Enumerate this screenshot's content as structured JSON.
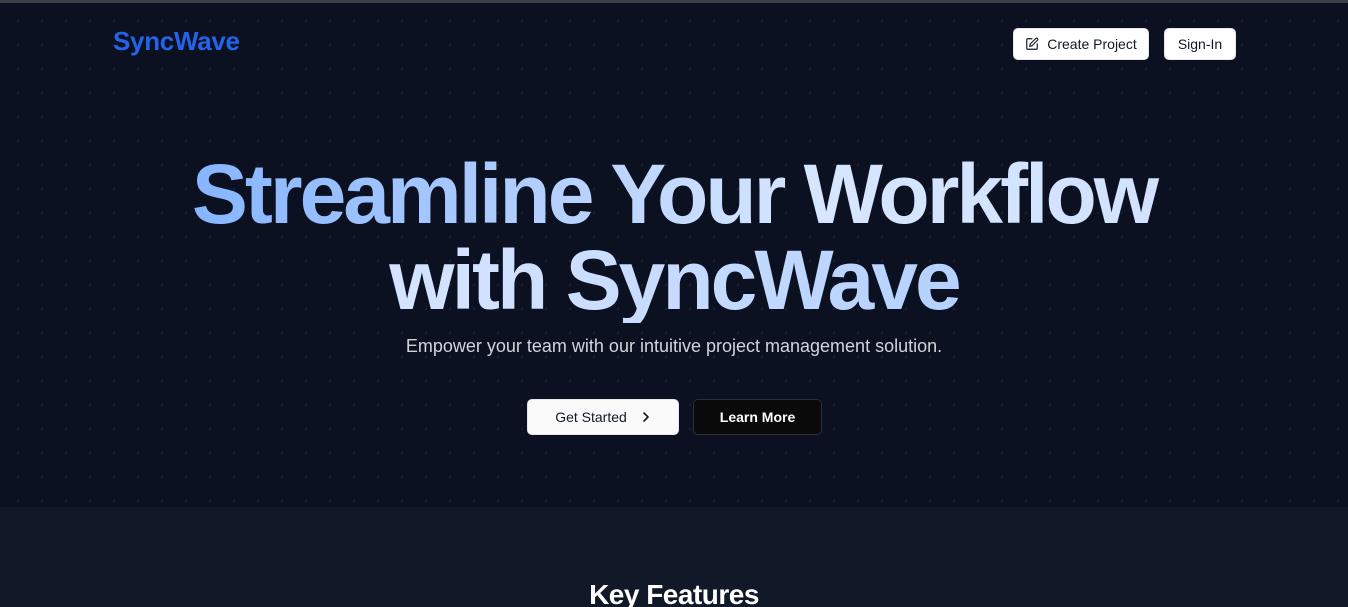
{
  "nav": {
    "brand": "SyncWave",
    "create_project_label": "Create Project",
    "create_project_icon": "edit-icon",
    "sign_in_label": "Sign-In"
  },
  "hero": {
    "headline_line1": "Streamline Your Workflow",
    "headline_line2": "with SyncWave",
    "subtitle": "Empower your team with our intuitive project management solution.",
    "get_started_label": "Get Started",
    "get_started_icon": "chevron-right-icon",
    "learn_more_label": "Learn More"
  },
  "features": {
    "title": "Key Features"
  },
  "colors": {
    "brand": "#2563eb",
    "hero_background": "#0b1120",
    "features_background": "#111827",
    "headline_gradient_start": "#6ea8ff",
    "headline_gradient_end": "#d6e6ff"
  }
}
